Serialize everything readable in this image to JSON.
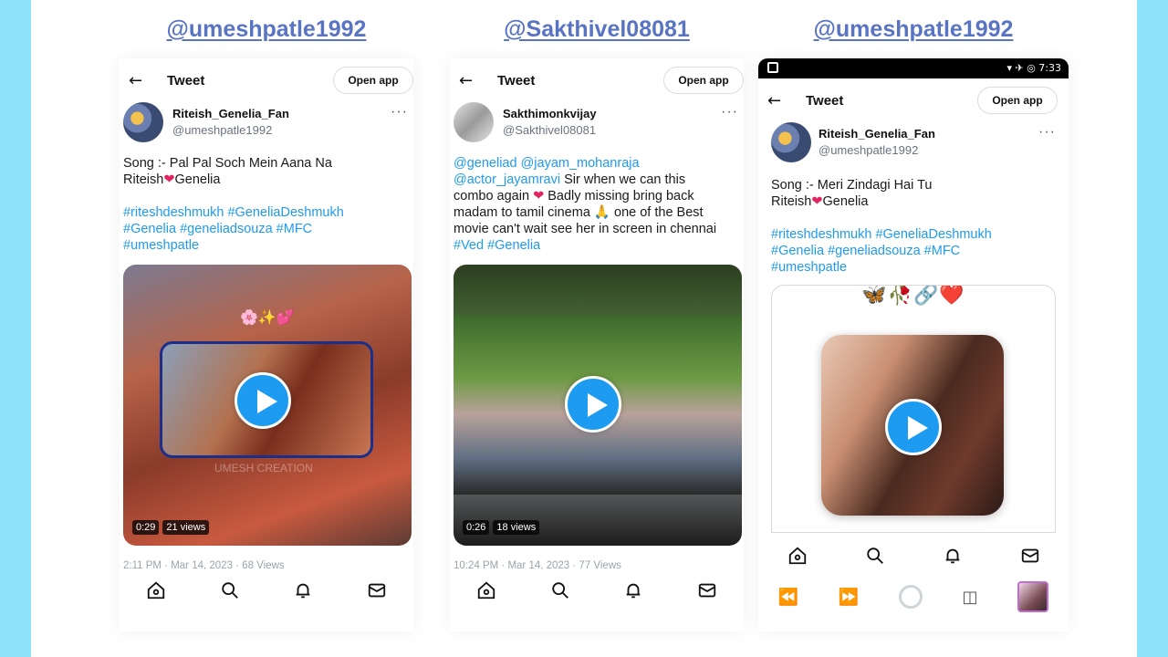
{
  "columns": [
    {
      "handle": "@umeshpatle1992",
      "topbar": {
        "title": "Tweet",
        "open_app": "Open app"
      },
      "author": {
        "name": "Riteish_Genelia_Fan",
        "handle": "@umeshpatle1992"
      },
      "text_line1": "Song :- Pal Pal Soch Mein Aana Na",
      "text_line2a": "Riteish",
      "text_line2b": "Genelia",
      "hashtags_line1": "#riteshdeshmukh #GeneliaDeshmukh",
      "hashtags_line2": "#Genelia #geneliadsouza #MFC",
      "hashtags_line3": "#umeshpatle",
      "media": {
        "sparkles": "🌸✨💕",
        "watermark": "UMESH CREATION",
        "duration": "0:29",
        "views": "21 views"
      },
      "meta": "2:11 PM · Mar 14, 2023 · 68 Views"
    },
    {
      "handle": "@Sakthivel08081",
      "topbar": {
        "title": "Tweet",
        "open_app": "Open app"
      },
      "author": {
        "name": "Sakthimonkvijay",
        "handle": "@Sakthivel08081"
      },
      "mentions_line1": "@geneliad @jayam_mohanraja",
      "mention2": "@actor_jayamravi",
      "text_line2": " Sir when we can this",
      "text_line3a": "combo again",
      "text_line3b": " Badly missing bring back",
      "text_line4a": "madam to tamil cinema",
      "text_line4b": " one of the Best",
      "text_line5": "movie can't wait see her in screen in chennai",
      "hashtags": "#Ved #Genelia",
      "media": {
        "duration": "0:26",
        "views": "18 views"
      },
      "meta": "10:24 PM · Mar 14, 2023 · 77 Views"
    },
    {
      "handle": "@umeshpatle1992",
      "status": {
        "time": "▾ ✈ ◎ 7:33"
      },
      "topbar": {
        "title": "Tweet",
        "open_app": "Open app"
      },
      "author": {
        "name": "Riteish_Genelia_Fan",
        "handle": "@umeshpatle1992"
      },
      "text_line1": "Song :- Meri Zindagi Hai Tu",
      "text_line2a": "Riteish",
      "text_line2b": "Genelia",
      "hashtags_line1": "#riteshdeshmukh #GeneliaDeshmukh",
      "hashtags_line2": "#Genelia #geneliadsouza #MFC",
      "hashtags_line3": "#umeshpatle",
      "media": {
        "emojis": "🦋🥀🔗❤️"
      }
    }
  ],
  "icons": {
    "heart": "❤",
    "pray": "🙏",
    "more": "···",
    "back": "←"
  },
  "colors": {
    "link": "#1d9bf0",
    "handle_heading": "#5a74c4",
    "background": "#8fe4fb"
  }
}
